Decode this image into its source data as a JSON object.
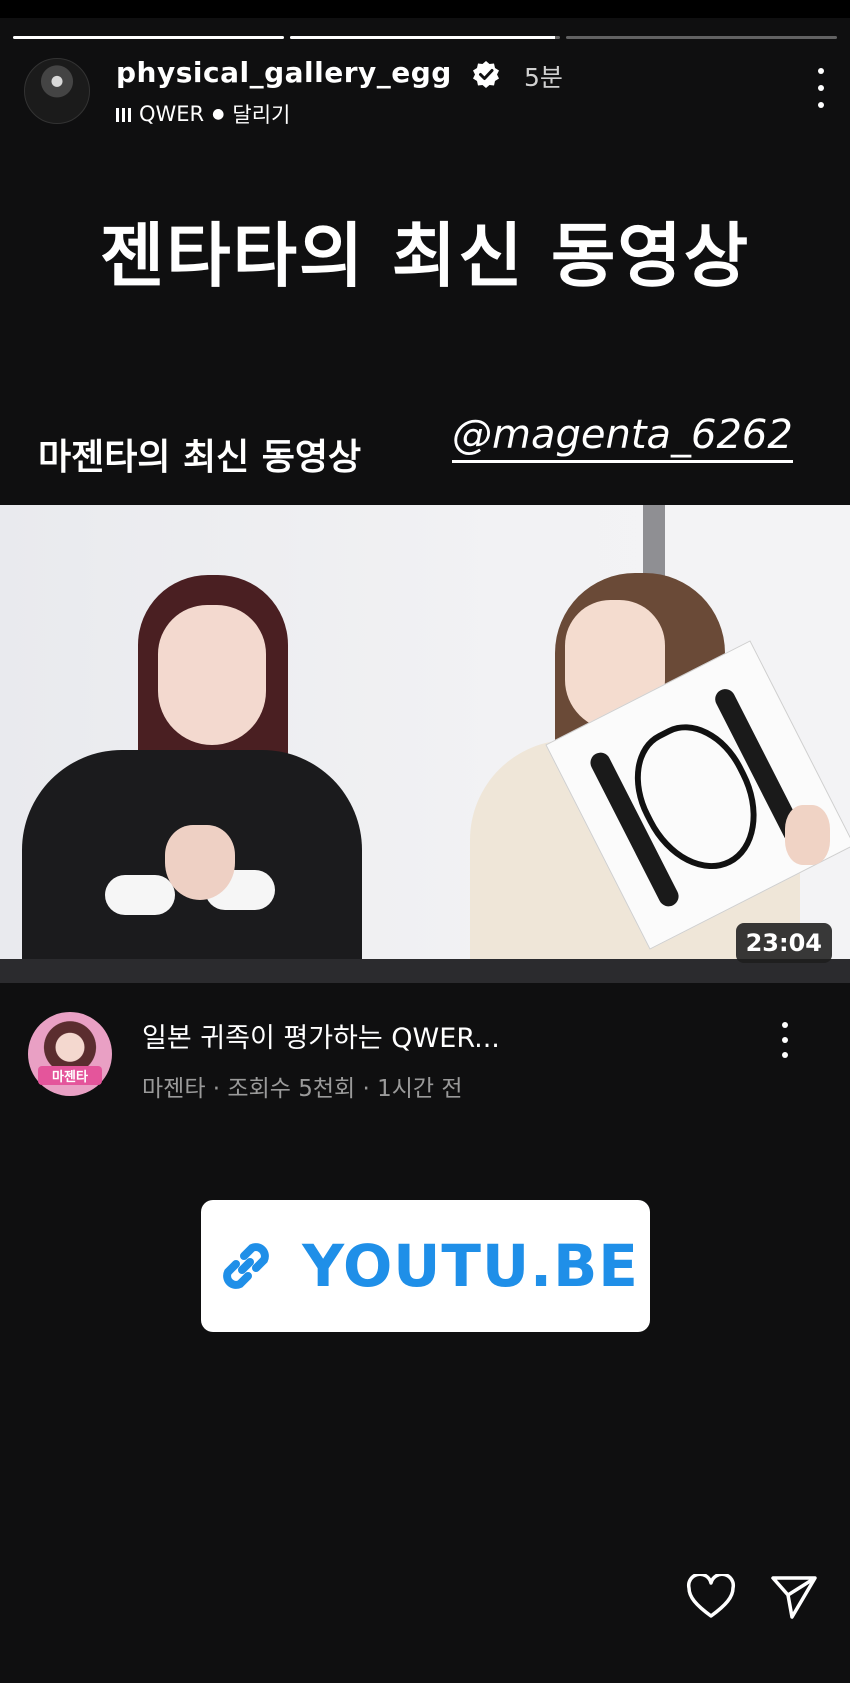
{
  "story": {
    "progress": [
      1,
      0.98,
      0
    ],
    "username": "physical_gallery_egg",
    "time_ago": "5분",
    "music_artist": "QWER",
    "music_song": "달리기"
  },
  "headline": "젠타타의 최신 동영상",
  "sub_caption": "마젠타의 최신 동영상",
  "mention": "@magenta_6262",
  "video": {
    "duration": "23:04",
    "title": "일본 귀족이 평가하는 QWER...",
    "meta": "마젠타 · 조회수 5천회 · 1시간 전",
    "channel_avatar_label": "마젠타"
  },
  "link_sticker": {
    "text": "YOUTU.BE",
    "color": "#1f8fe8"
  },
  "icons": {
    "verified": "verified-badge-icon",
    "more": "more-vertical-icon",
    "music": "music-bars-icon",
    "link": "link-icon",
    "like": "heart-icon",
    "share": "send-icon"
  }
}
